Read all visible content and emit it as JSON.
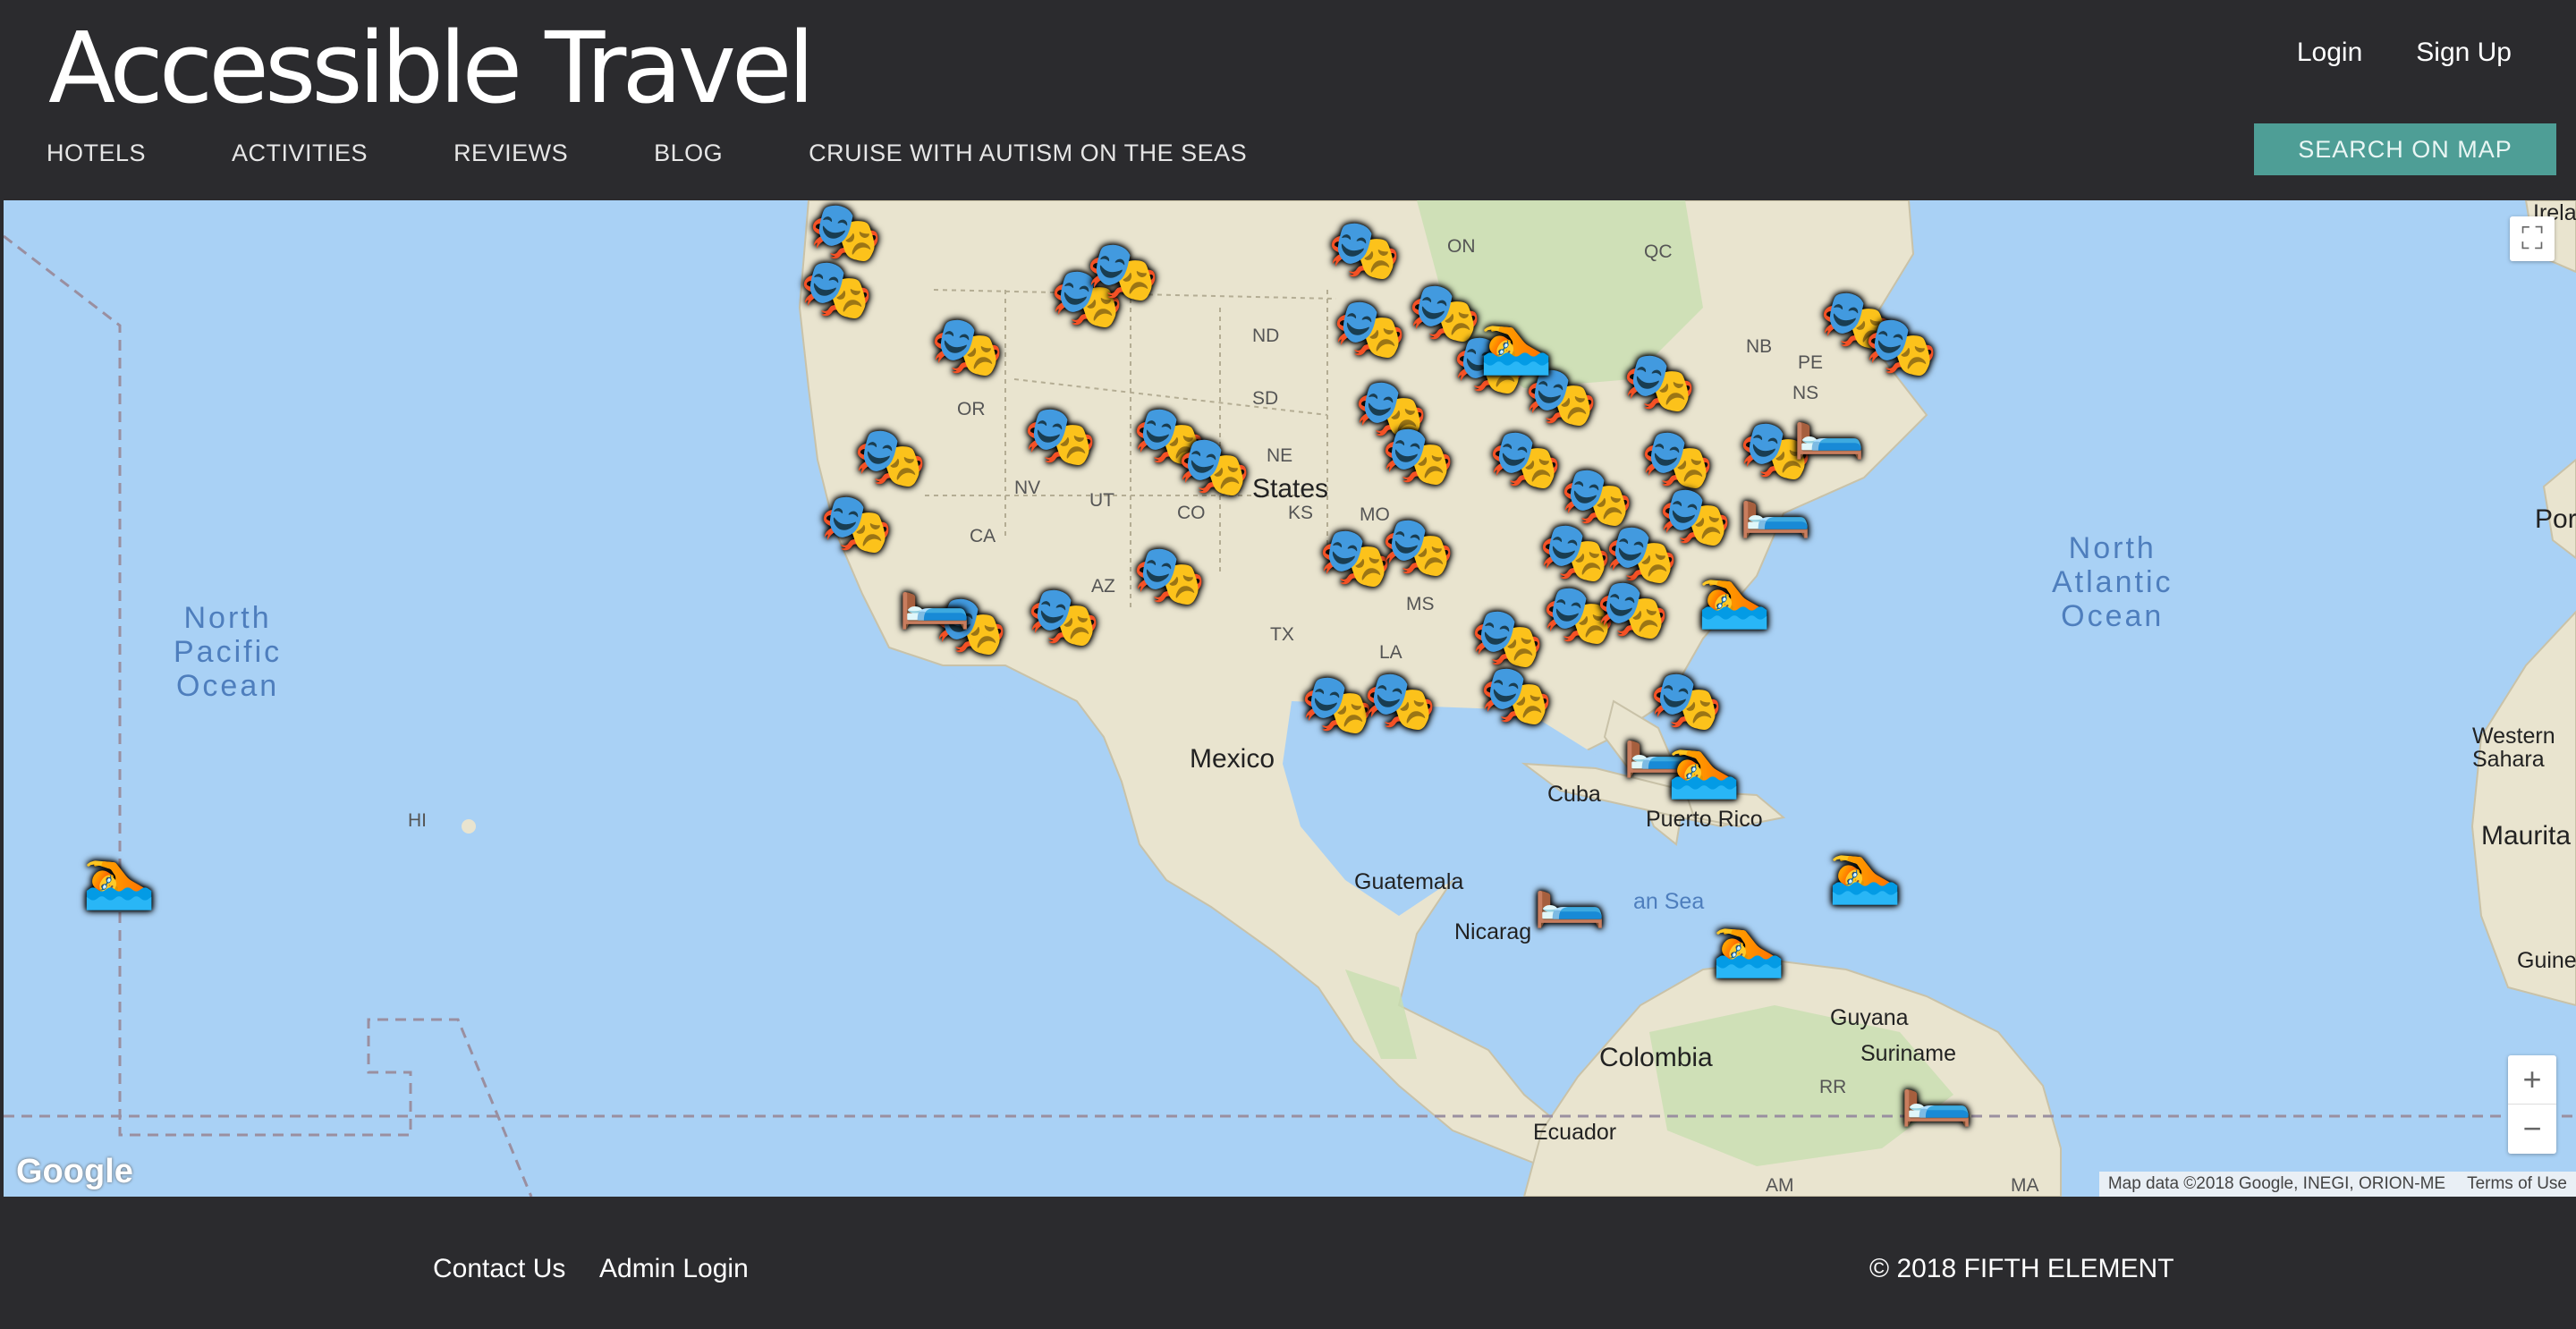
{
  "header": {
    "brand": "Accessible Travel",
    "nav": [
      "HOTELS",
      "ACTIVITIES",
      "REVIEWS",
      "BLOG",
      "CRUISE WITH AUTISM ON THE SEAS"
    ],
    "auth": {
      "login": "Login",
      "signup": "Sign Up"
    },
    "search_button": "SEARCH ON MAP"
  },
  "map": {
    "oceans": {
      "pacific": "North\nPacific\nOcean",
      "atlantic": "North\nAtlantic\nOcean"
    },
    "labels": {
      "states": "States",
      "mexico": "Mexico",
      "cuba": "Cuba",
      "puerto_rico": "Puerto Rico",
      "guatemala": "Guatemala",
      "nicaragua": "Nicarag",
      "caribbean": "an Sea",
      "colombia": "Colombia",
      "ecuador": "Ecuador",
      "guyana": "Guyana",
      "suriname": "Suriname",
      "western_sahara": "Western\nSahara",
      "mauritania": "Maurita",
      "guinea": "Guine",
      "ireland": "Irela",
      "portugal": "Por",
      "hi": "HI",
      "on": "ON",
      "qc": "QC",
      "nb": "NB",
      "pe": "PE",
      "ns": "NS",
      "nd": "ND",
      "sd": "SD",
      "ne": "NE",
      "ks": "KS",
      "mo": "MO",
      "or": "OR",
      "nv": "NV",
      "ut": "UT",
      "co": "CO",
      "ca": "CA",
      "az": "AZ",
      "tx": "TX",
      "la": "LA",
      "ms": "MS",
      "rr": "RR",
      "am": "AM",
      "ma": "MA"
    },
    "controls": {
      "fullscreen": "⛶",
      "zoom_in": "+",
      "zoom_out": "−"
    },
    "google": "Google",
    "attribution": "Map data ©2018 Google, INEGI, ORION-ME",
    "terms": "Terms of Use",
    "marker_icons": {
      "activity": "theater-masks-icon",
      "hotel": "bed-icon",
      "swim": "swimmer-icon"
    }
  },
  "footer": {
    "contact": "Contact Us",
    "admin": "Admin Login",
    "copyright": "© 2018 FIFTH ELEMENT"
  }
}
